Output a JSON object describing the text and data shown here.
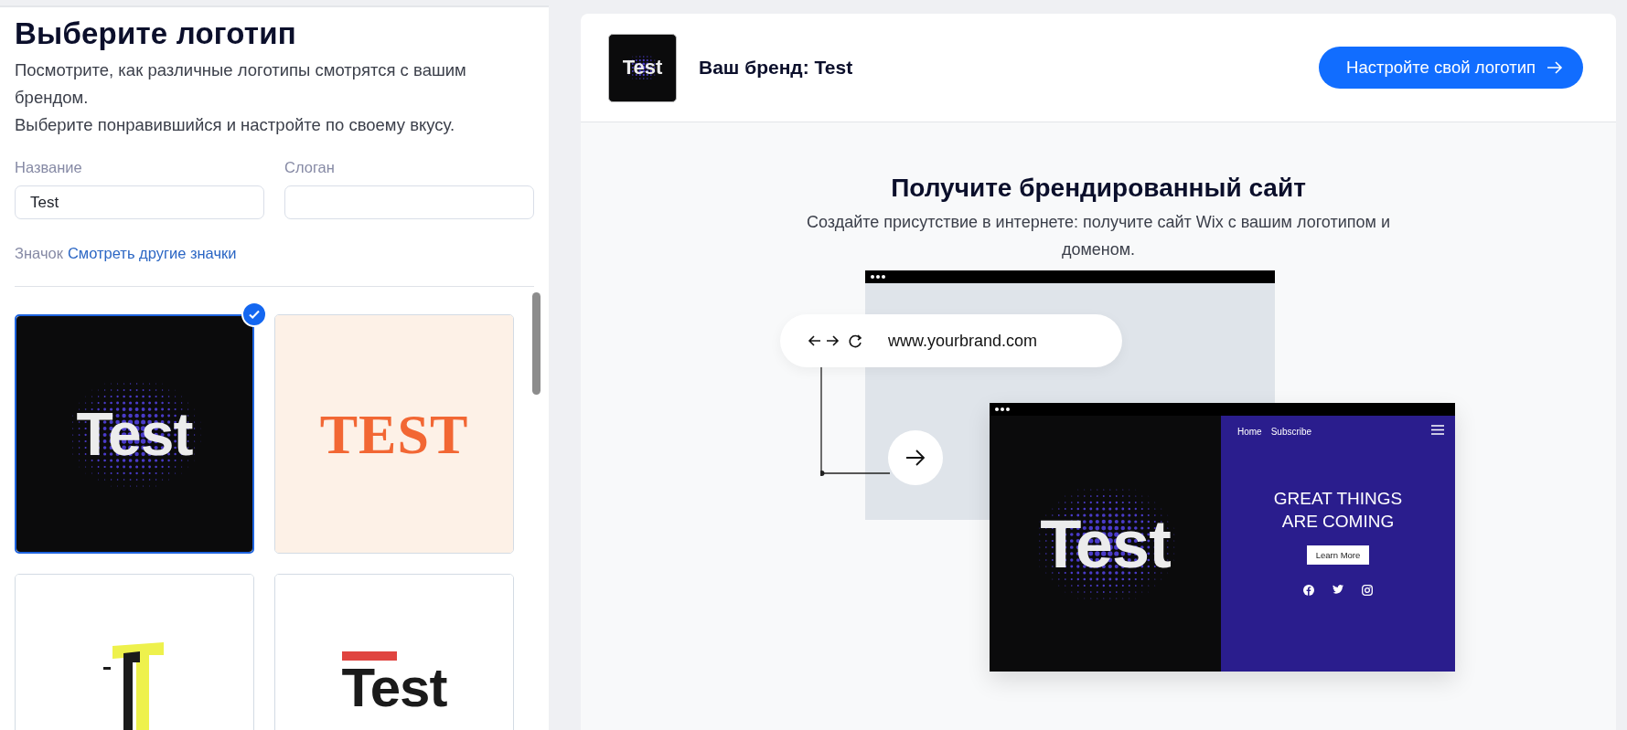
{
  "left": {
    "title": "Выберите логотип",
    "intro": [
      "Посмотрите, как различные логотипы смотрятся с вашим брендом.",
      "Выберите понравившийся и настройте по своему вкусу."
    ],
    "fields": [
      {
        "label": "Название",
        "value": "Test"
      },
      {
        "label": "Слоган"
      }
    ],
    "icon_row": {
      "label": "Значок",
      "link": "Смотреть другие значки"
    },
    "logos": [
      {
        "kind": "halftone",
        "text": "Test",
        "selected": true
      },
      {
        "kind": "serif",
        "text": "TEST",
        "selected": false
      },
      {
        "kind": "letter-mark",
        "selected": false
      },
      {
        "kind": "bar",
        "text": "Test",
        "selected": false
      }
    ]
  },
  "header": {
    "logo_text": "Test",
    "brand": "Ваш бренд: Test",
    "button": "Настройте свой логотип"
  },
  "promo": {
    "title": "Получите брендированный сайт",
    "subtitle": "Создайте присутствие в интернете: получите сайт Wix с вашим логотипом и доменом.",
    "url": "www.yourbrand.com",
    "site": {
      "nav": [
        "Home",
        "Subscribe"
      ],
      "logo": "Test",
      "headline": "GREAT THINGS ARE COMING",
      "button": "Learn More"
    }
  }
}
